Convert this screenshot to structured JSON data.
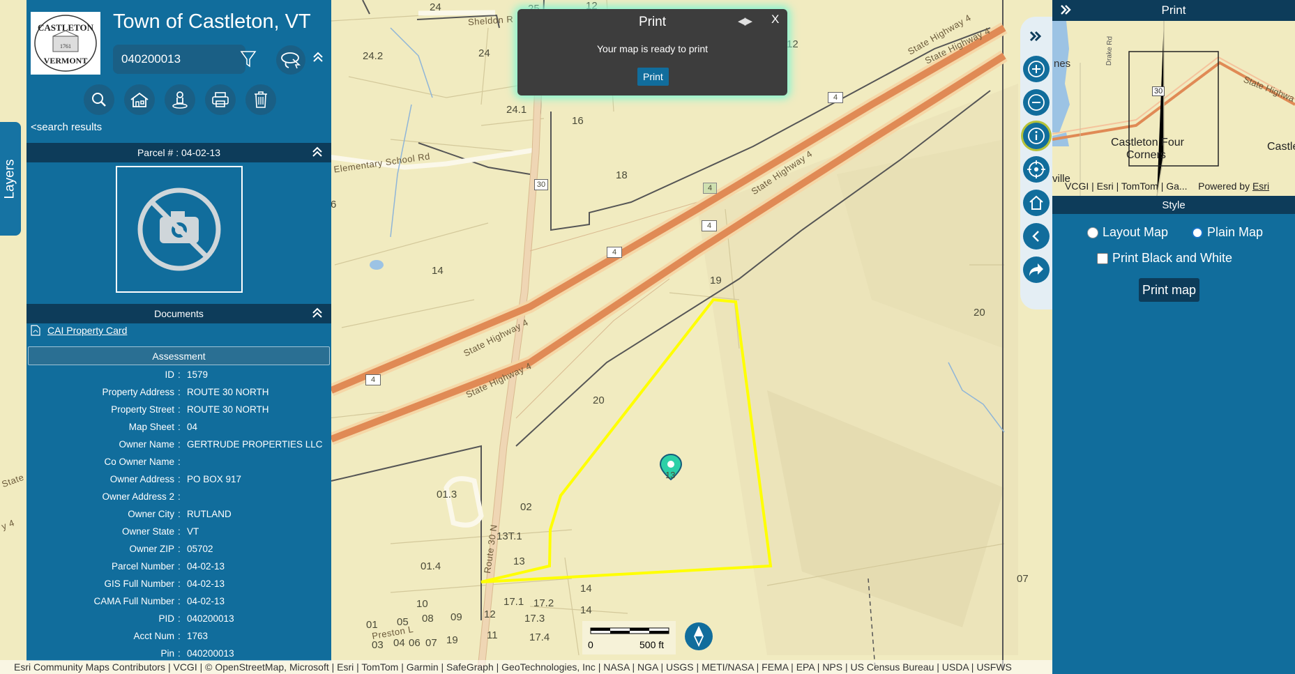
{
  "app": {
    "town_title": "Town of Castleton, VT",
    "logo": {
      "top_text": "CASTLETON",
      "bottom_text": "VERMONT",
      "year": "1761"
    }
  },
  "search": {
    "value": "040200013"
  },
  "toolbar": {
    "icons": [
      "search-icon",
      "home-icon",
      "person-pin-icon",
      "printer-icon",
      "trash-icon"
    ],
    "back_label": "<search results"
  },
  "layers_tab": {
    "label": "Layers"
  },
  "parcel": {
    "header": "Parcel # : 04-02-13"
  },
  "documents": {
    "header": "Documents",
    "link_label": "CAI Property Card"
  },
  "assessment": {
    "header": "Assessment",
    "rows": [
      {
        "key": "ID",
        "value": "1579"
      },
      {
        "key": "Property Address",
        "value": "ROUTE 30 NORTH"
      },
      {
        "key": "Property Street",
        "value": "ROUTE 30 NORTH"
      },
      {
        "key": "Map Sheet",
        "value": "04"
      },
      {
        "key": "Owner Name",
        "value": "GERTRUDE PROPERTIES LLC"
      },
      {
        "key": "Co Owner Name",
        "value": ""
      },
      {
        "key": "Owner Address",
        "value": "PO BOX 917"
      },
      {
        "key": "Owner Address 2",
        "value": ""
      },
      {
        "key": "Owner City",
        "value": "RUTLAND"
      },
      {
        "key": "Owner State",
        "value": "VT"
      },
      {
        "key": "Owner ZIP",
        "value": "05702"
      },
      {
        "key": "Parcel Number",
        "value": "04-02-13"
      },
      {
        "key": "GIS Full Number",
        "value": "04-02-13"
      },
      {
        "key": "CAMA Full Number",
        "value": "04-02-13"
      },
      {
        "key": "PID",
        "value": "040200013"
      },
      {
        "key": "Acct Num",
        "value": "1763"
      },
      {
        "key": "Pin",
        "value": "040200013"
      }
    ]
  },
  "print_popup": {
    "title": "Print",
    "nav": "◀▶",
    "close": "X",
    "message": "Your map is ready to print",
    "button": "Print"
  },
  "print_panel": {
    "title": "Print",
    "style_header": "Style",
    "layout_option": "Layout Map",
    "plain_option": "Plain Map",
    "selected": "Plain Map",
    "bw_option": "Print Black and White",
    "bw_checked": false,
    "print_button": "Print map",
    "overview": {
      "labels": [
        "nes",
        "Drake Rd",
        "30",
        "Castleton Four",
        "Corners",
        "Castle",
        "ville",
        "State Highwa"
      ],
      "attribution": "VCGI | Esri | TomTom | Ga...",
      "powered_by": "Powered by",
      "esri": "Esri"
    }
  },
  "map": {
    "parcel_labels": [
      "24",
      "25",
      "12",
      "12",
      "24.2",
      "24",
      "24.1",
      "16",
      "18",
      "14",
      "19",
      "20",
      "20",
      "13",
      "01.3",
      "02",
      "13T.1",
      "13",
      "01.4",
      "10",
      "17.1",
      "17.2",
      "17.3",
      "17.4",
      "12",
      "11",
      "01",
      "05",
      "08",
      "09",
      "03",
      "04",
      "06",
      "07",
      "19",
      "14",
      "14",
      "07",
      "6"
    ],
    "road_labels": [
      "Sheldon R",
      "Elementary School Rd",
      "State Highway 4",
      "State Highway 4",
      "State Highway 4",
      "State Highway 4",
      "State Highway 4",
      "Route 30 N",
      "Preston L",
      "State",
      "y 4"
    ],
    "shields": [
      "30",
      "4",
      "4",
      "4",
      "4",
      "4"
    ],
    "parcel_color": "#ffff00"
  },
  "scale": {
    "zero": "0",
    "distance": "500 ft"
  },
  "attribution": "Esri Community Maps Contributors | VCGI | © OpenStreetMap, Microsoft | Esri | TomTom | Garmin | SafeGraph | GeoTechnologies, Inc | NASA | NGA | USGS | METI/NASA | FEMA | EPA | NPS | US Census Bureau | USDA | USFWS"
}
